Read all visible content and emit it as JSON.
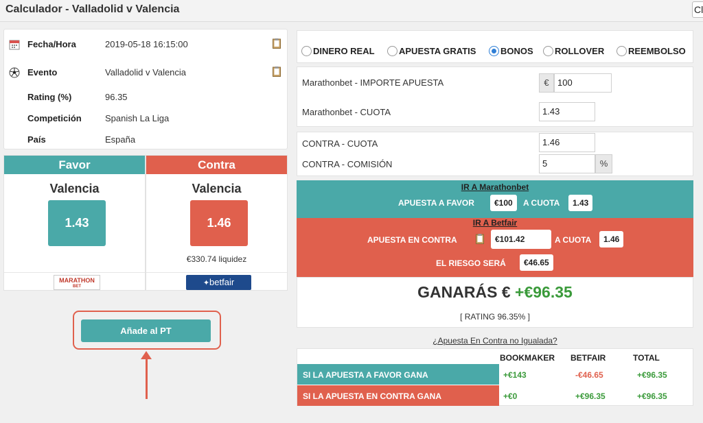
{
  "window": {
    "title": "Calculador - Valladolid v Valencia",
    "close_label": "Cl"
  },
  "info": {
    "rows": [
      {
        "label": "Fecha/Hora",
        "value": "2019-05-18 16:15:00",
        "icon": "calendar-icon"
      },
      {
        "label": "Evento",
        "value": "Valladolid v Valencia",
        "icon": "soccer-ball-icon"
      },
      {
        "label": "Rating (%)",
        "value": "96.35"
      },
      {
        "label": "Competición",
        "value": "Spanish La Liga"
      },
      {
        "label": "País",
        "value": "España"
      }
    ]
  },
  "favor": {
    "header": "Favor",
    "team": "Valencia",
    "odd": "1.43",
    "bookmaker": "MARATHON",
    "bookmaker_sub": "BET",
    "color": "#4aa9a8"
  },
  "contra": {
    "header": "Contra",
    "team": "Valencia",
    "odd": "1.46",
    "liquidity": "€330.74 liquidez",
    "exchange": "betfair",
    "color": "#e0604d"
  },
  "add_button": "Añade al PT",
  "modes": [
    {
      "label": "DINERO REAL",
      "selected": false
    },
    {
      "label": "APUESTA GRATIS",
      "selected": false
    },
    {
      "label": "BONOS",
      "selected": true
    },
    {
      "label": "ROLLOVER",
      "selected": false
    },
    {
      "label": "REEMBOLSO",
      "selected": false
    }
  ],
  "back": {
    "stake_label": "Marathonbet - IMPORTE APUESTA",
    "currency": "€",
    "stake_value": "100",
    "odd_label": "Marathonbet - CUOTA",
    "odd_value": "1.43"
  },
  "lay": {
    "odd_label": "CONTRA - CUOTA",
    "odd_value": "1.46",
    "commission_label": "CONTRA - COMISIÓN",
    "commission_value": "5",
    "percent": "%"
  },
  "result": {
    "back_link": "IR A Marathonbet",
    "back_stake_label": "APUESTA A FAVOR",
    "back_stake": "€100",
    "back_odd_label": "A CUOTA",
    "back_odd": "1.43",
    "lay_link": "IR A Betfair",
    "lay_stake_label": "APUESTA EN CONTRA",
    "lay_stake": "€101.42",
    "lay_odd_label": "A CUOTA",
    "lay_odd": "1.46",
    "risk_label": "EL RIESGO SERÁ",
    "risk": "€46.65",
    "win_label": "GANARÁS €",
    "win_amount": "+€96.35",
    "rating_line": "[ RATING 96.35% ]"
  },
  "unmatched_link": "¿Apuesta En Contra no Igualada?",
  "table": {
    "headers": [
      "BOOKMAKER",
      "BETFAIR",
      "TOTAL"
    ],
    "rows": [
      {
        "label": "SI LA APUESTA A FAVOR GANA",
        "bookmaker": "+€143",
        "betfair": "-€46.65",
        "total": "+€96.35"
      },
      {
        "label": "SI LA APUESTA EN CONTRA GANA",
        "bookmaker": "+€0",
        "betfair": "+€96.35",
        "total": "+€96.35"
      }
    ]
  }
}
